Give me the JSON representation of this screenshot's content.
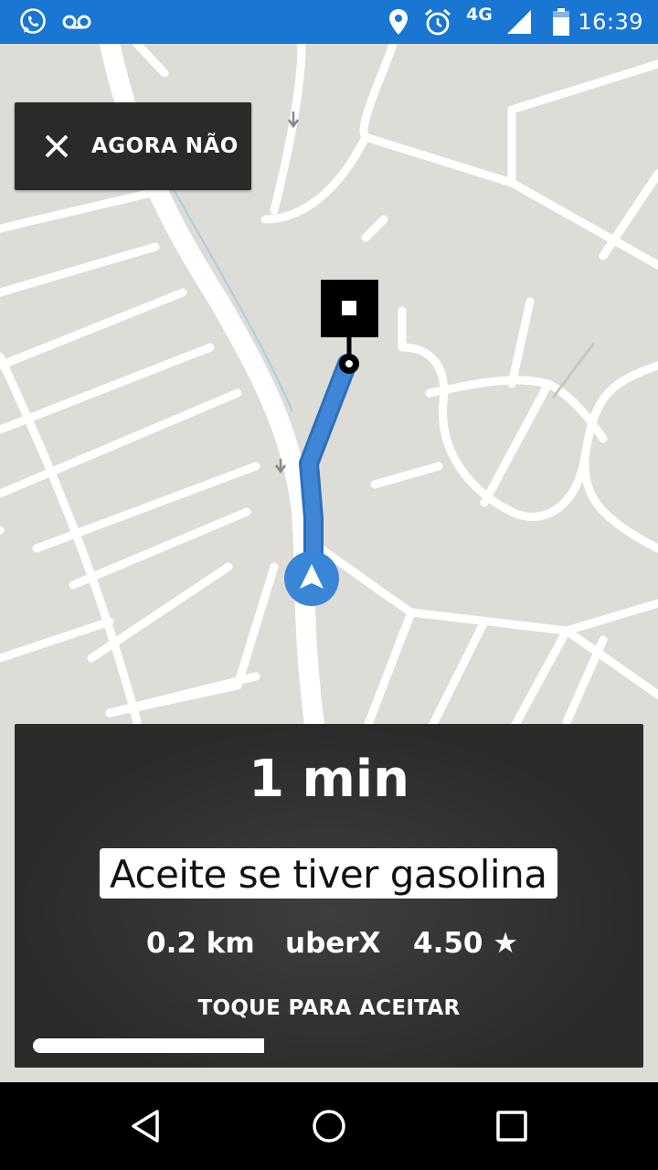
{
  "status_bar": {
    "time": "16:39",
    "network": "4G",
    "left_icons": [
      "whatsapp-icon",
      "voicemail-icon"
    ],
    "right_icons": [
      "location-icon",
      "alarm-icon",
      "signal-icon",
      "battery-icon"
    ]
  },
  "map": {
    "route_color": "#3f86d6",
    "marker_color": "#3a86d6"
  },
  "dismiss": {
    "label": "AGORA NÃO"
  },
  "request": {
    "eta": "1 min",
    "note": "Aceite se tiver gasolina",
    "distance": "0.2 km",
    "product": "uberX",
    "rating": "4.50 ★",
    "accept_label": "TOQUE PARA ACEITAR",
    "timer_remaining": 0.39
  },
  "nav_bar": {
    "buttons": [
      "back-icon",
      "home-icon",
      "recents-icon"
    ]
  }
}
